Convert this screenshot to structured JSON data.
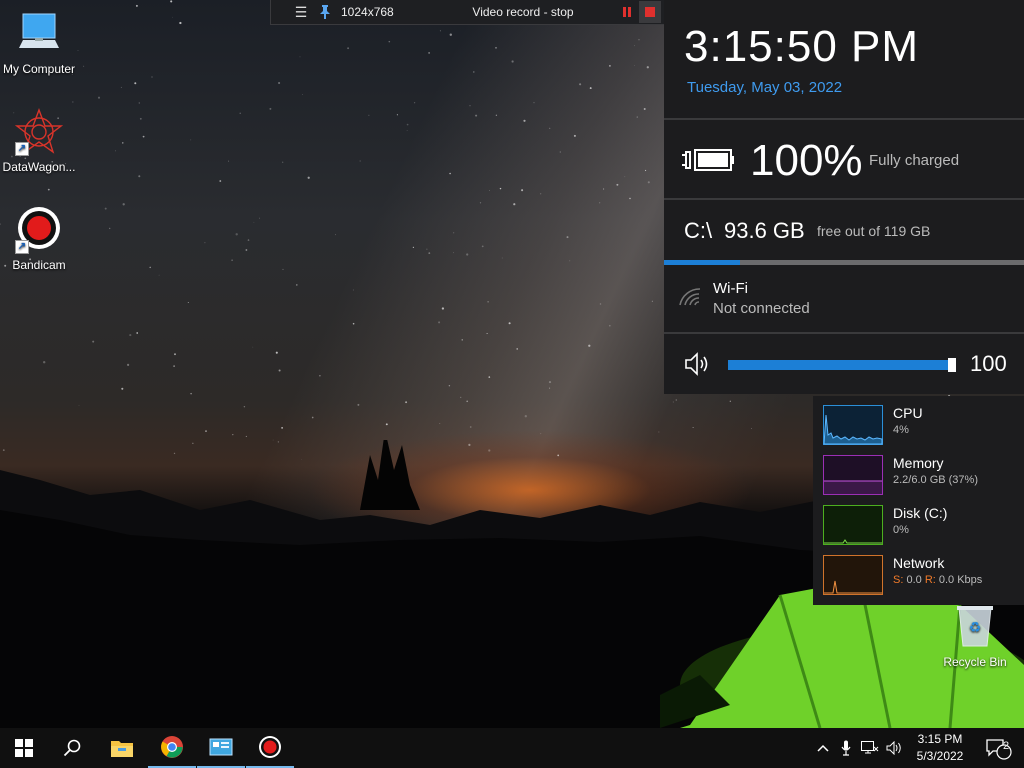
{
  "desktop": {
    "icons": [
      {
        "label": "My Computer"
      },
      {
        "label": "DataWagon..."
      },
      {
        "label": "Bandicam"
      }
    ],
    "recycle_bin": {
      "label": "Recycle Bin"
    }
  },
  "bandicam_bar": {
    "resolution": "1024x768",
    "title": "Video record - stop",
    "icons": [
      "menu-icon",
      "pin-icon",
      "pause-icon",
      "stop-icon",
      "camera-icon",
      "pencil-icon",
      "close-icon"
    ]
  },
  "info_panel": {
    "time": "3:15:50 PM",
    "date": "Tuesday, May 03, 2022",
    "battery": {
      "percent": "100%",
      "status": "Fully charged",
      "level": 100
    },
    "disk": {
      "drive": "C:\\",
      "free": "93.6 GB",
      "total_text": "free out of 119 GB",
      "used_fraction": 0.21
    },
    "wifi": {
      "name": "Wi-Fi",
      "status": "Not connected"
    },
    "volume": {
      "value": "100",
      "level": 100
    }
  },
  "performance": {
    "cpu": {
      "name": "CPU",
      "value": "4%"
    },
    "memory": {
      "name": "Memory",
      "value": "2.2/6.0 GB (37%)"
    },
    "disk": {
      "name": "Disk (C:)",
      "value": "0%"
    },
    "network": {
      "name": "Network",
      "s_label": "S:",
      "s_value": " 0.0 ",
      "r_label": "R:",
      "r_value": " 0.0 Kbps"
    }
  },
  "taskbar": {
    "time": "3:15 PM",
    "date": "5/3/2022",
    "notification_count": "2",
    "apps": [
      "file-explorer-icon",
      "chrome-icon",
      "control-panel-icon",
      "bandicam-icon"
    ]
  },
  "colors": {
    "accent_blue": "#1c7fd6",
    "date_blue": "#3f9bef",
    "cpu": "#2b8fd8",
    "memory": "#9b2fb5",
    "disk": "#4caf1f",
    "network": "#d0732b"
  }
}
